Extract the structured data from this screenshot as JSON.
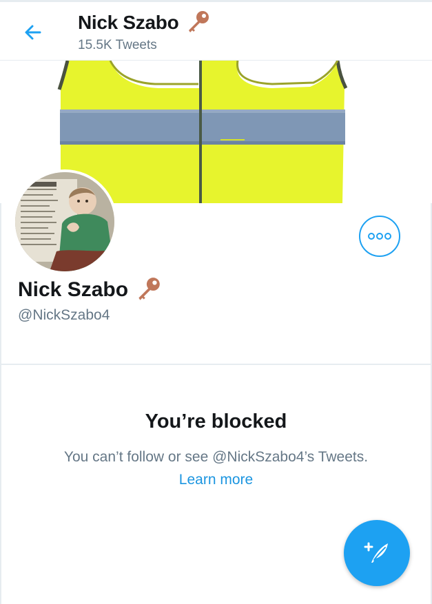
{
  "header": {
    "name": "Nick Szabo",
    "tweets_count": "15.5K Tweets"
  },
  "profile": {
    "name": "Nick Szabo",
    "handle": "@NickSzabo4"
  },
  "blocked": {
    "title": "You’re blocked",
    "message": "You can’t follow or see @NickSzabo4’s Tweets.",
    "learn_more": "Learn more"
  },
  "icons": {
    "back": "back-arrow-icon",
    "name_emoji": "key-icon",
    "more": "more-options-icon",
    "compose": "compose-tweet-icon"
  },
  "colors": {
    "accent": "#1da1f2",
    "link": "#1b95e0",
    "secondary_text": "#657786",
    "primary_text": "#14171a",
    "key": "#c0775a",
    "vest_yellow": "#e7f42d",
    "reflective_stripe": "#7f97b5"
  }
}
